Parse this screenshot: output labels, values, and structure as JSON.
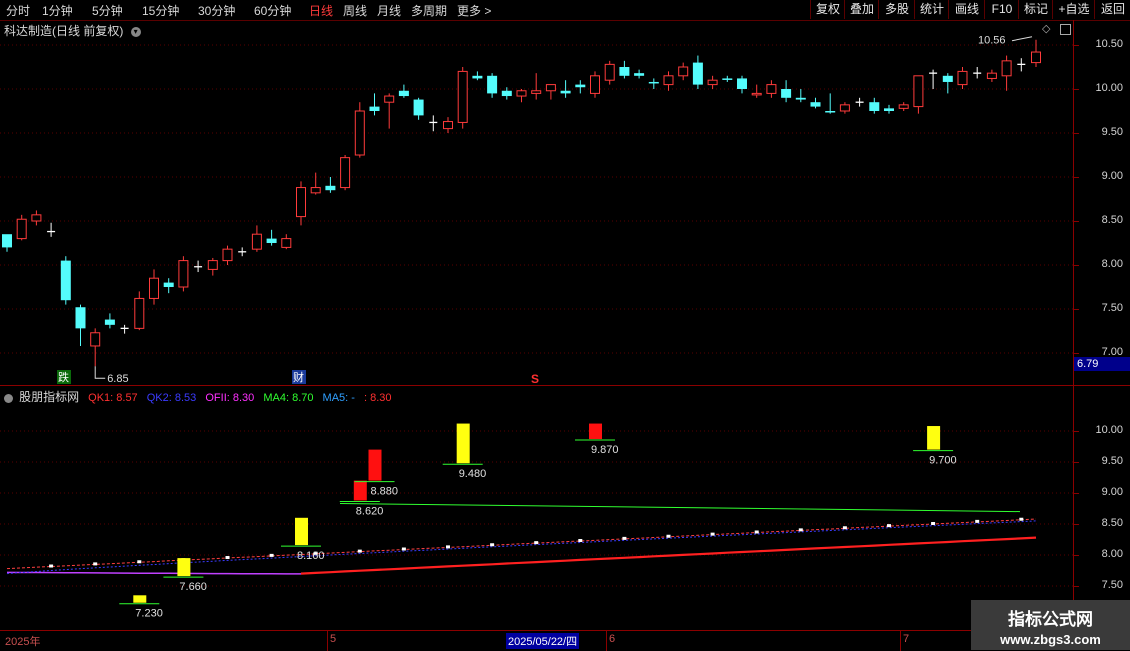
{
  "toolbar": {
    "periods": [
      "分时",
      "1分钟",
      "5分钟",
      "15分钟",
      "30分钟",
      "60分钟",
      "日线",
      "周线",
      "月线",
      "多周期",
      "更多 >"
    ],
    "active_period": "日线",
    "right_buttons": [
      "复权",
      "叠加",
      "多股",
      "统计",
      "画线",
      "F10",
      "标记",
      "+自选",
      "返回"
    ]
  },
  "main_panel": {
    "title": "科达制造(日线 前复权)",
    "price_axis": [
      "10.50",
      "10.00",
      "9.50",
      "9.00",
      "8.50",
      "8.00",
      "7.50",
      "7.00"
    ],
    "current_price": "6.79",
    "high_label": "10.56",
    "low_label": "6.85",
    "markers": {
      "die": "跌",
      "cai": "财",
      "s": "S"
    }
  },
  "indicator_panel": {
    "title": "股朋指标网",
    "legend": [
      {
        "label": "QK1: 8.57",
        "color": "#ff3030"
      },
      {
        "label": "QK2: 8.53",
        "color": "#3b3bff"
      },
      {
        "label": "OFII: 8.30",
        "color": "#ff30ff"
      },
      {
        "label": "MA4: 8.70",
        "color": "#30ff30"
      },
      {
        "label": "MA5: -",
        "color": "#30a0ff"
      },
      {
        "label": ": 8.30",
        "color": "#ff3030"
      }
    ],
    "axis": [
      "10.00",
      "9.50",
      "9.00",
      "8.50",
      "8.00",
      "7.50"
    ],
    "signal_labels": [
      "7.230",
      "7.660",
      "8.160",
      "8.620",
      "8.880",
      "9.480",
      "9.870",
      "9.700"
    ]
  },
  "date_bar": {
    "labels": [
      "2025年",
      "5",
      "2025/05/22/四",
      "6",
      "7"
    ]
  },
  "watermark": {
    "name": "指标公式网",
    "url": "www.zbgs3.com"
  },
  "chart_data": {
    "type": "candlestick",
    "title": "科达制造(日线 前复权)",
    "ylim": [
      6.79,
      10.7
    ],
    "candles": [
      {
        "o": 8.2,
        "h": 8.3,
        "l": 8.15,
        "c": 8.35,
        "color": "cyan"
      },
      {
        "o": 8.3,
        "h": 8.57,
        "l": 8.28,
        "c": 8.52
      },
      {
        "o": 8.5,
        "h": 8.62,
        "l": 8.45,
        "c": 8.57
      },
      {
        "o": 8.38,
        "h": 8.48,
        "l": 8.32,
        "c": 8.38,
        "doji": true
      },
      {
        "o": 8.05,
        "h": 8.1,
        "l": 7.55,
        "c": 7.6,
        "color": "cyan"
      },
      {
        "o": 7.52,
        "h": 7.55,
        "l": 7.08,
        "c": 7.28,
        "color": "cyan"
      },
      {
        "o": 7.08,
        "h": 7.28,
        "l": 6.85,
        "c": 7.23
      },
      {
        "o": 7.38,
        "h": 7.45,
        "l": 7.28,
        "c": 7.32,
        "color": "cyan"
      },
      {
        "o": 7.28,
        "h": 7.32,
        "l": 7.22,
        "c": 7.28,
        "doji": true
      },
      {
        "o": 7.28,
        "h": 7.7,
        "l": 7.26,
        "c": 7.62
      },
      {
        "o": 7.62,
        "h": 7.95,
        "l": 7.55,
        "c": 7.85
      },
      {
        "o": 7.8,
        "h": 7.85,
        "l": 7.68,
        "c": 7.75,
        "color": "cyan"
      },
      {
        "o": 7.75,
        "h": 8.1,
        "l": 7.7,
        "c": 8.05
      },
      {
        "o": 7.98,
        "h": 8.05,
        "l": 7.92,
        "c": 7.98,
        "doji": true
      },
      {
        "o": 7.95,
        "h": 8.08,
        "l": 7.88,
        "c": 8.05
      },
      {
        "o": 8.05,
        "h": 8.22,
        "l": 8.0,
        "c": 8.18
      },
      {
        "o": 8.15,
        "h": 8.2,
        "l": 8.1,
        "c": 8.15,
        "doji": true
      },
      {
        "o": 8.18,
        "h": 8.45,
        "l": 8.15,
        "c": 8.35
      },
      {
        "o": 8.3,
        "h": 8.4,
        "l": 8.22,
        "c": 8.25,
        "color": "cyan"
      },
      {
        "o": 8.2,
        "h": 8.35,
        "l": 8.18,
        "c": 8.3
      },
      {
        "o": 8.55,
        "h": 8.95,
        "l": 8.45,
        "c": 8.88
      },
      {
        "o": 8.82,
        "h": 9.05,
        "l": 8.8,
        "c": 8.88
      },
      {
        "o": 8.9,
        "h": 9.0,
        "l": 8.82,
        "c": 8.85,
        "color": "cyan"
      },
      {
        "o": 8.88,
        "h": 9.25,
        "l": 8.85,
        "c": 9.22
      },
      {
        "o": 9.25,
        "h": 9.85,
        "l": 9.22,
        "c": 9.75
      },
      {
        "o": 9.8,
        "h": 9.95,
        "l": 9.7,
        "c": 9.75,
        "color": "cyan"
      },
      {
        "o": 9.85,
        "h": 9.95,
        "l": 9.55,
        "c": 9.92
      },
      {
        "o": 9.98,
        "h": 10.05,
        "l": 9.9,
        "c": 9.92,
        "color": "cyan"
      },
      {
        "o": 9.88,
        "h": 9.9,
        "l": 9.65,
        "c": 9.7,
        "color": "cyan"
      },
      {
        "o": 9.62,
        "h": 9.7,
        "l": 9.52,
        "c": 9.62,
        "doji": true
      },
      {
        "o": 9.55,
        "h": 9.68,
        "l": 9.5,
        "c": 9.63
      },
      {
        "o": 9.62,
        "h": 10.25,
        "l": 9.55,
        "c": 10.2
      },
      {
        "o": 10.15,
        "h": 10.2,
        "l": 10.1,
        "c": 10.12,
        "color": "cyan"
      },
      {
        "o": 10.15,
        "h": 10.18,
        "l": 9.9,
        "c": 9.95,
        "color": "cyan"
      },
      {
        "o": 9.98,
        "h": 10.02,
        "l": 9.88,
        "c": 9.92,
        "color": "cyan"
      },
      {
        "o": 9.92,
        "h": 10.0,
        "l": 9.85,
        "c": 9.98
      },
      {
        "o": 9.95,
        "h": 10.18,
        "l": 9.88,
        "c": 9.98
      },
      {
        "o": 9.98,
        "h": 10.05,
        "l": 9.88,
        "c": 10.05
      },
      {
        "o": 9.98,
        "h": 10.1,
        "l": 9.9,
        "c": 9.95,
        "color": "cyan"
      },
      {
        "o": 10.05,
        "h": 10.1,
        "l": 9.95,
        "c": 10.02,
        "color": "cyan"
      },
      {
        "o": 9.95,
        "h": 10.2,
        "l": 9.9,
        "c": 10.15
      },
      {
        "o": 10.1,
        "h": 10.32,
        "l": 10.05,
        "c": 10.28
      },
      {
        "o": 10.25,
        "h": 10.32,
        "l": 10.12,
        "c": 10.15,
        "color": "cyan"
      },
      {
        "o": 10.18,
        "h": 10.22,
        "l": 10.12,
        "c": 10.15,
        "color": "cyan"
      },
      {
        "o": 10.08,
        "h": 10.12,
        "l": 10.0,
        "c": 10.08,
        "color": "cyan"
      },
      {
        "o": 10.05,
        "h": 10.2,
        "l": 9.98,
        "c": 10.15
      },
      {
        "o": 10.15,
        "h": 10.3,
        "l": 10.1,
        "c": 10.25
      },
      {
        "o": 10.3,
        "h": 10.38,
        "l": 10.0,
        "c": 10.05,
        "color": "cyan"
      },
      {
        "o": 10.05,
        "h": 10.15,
        "l": 10.0,
        "c": 10.1
      },
      {
        "o": 10.12,
        "h": 10.15,
        "l": 10.08,
        "c": 10.12,
        "color": "cyan"
      },
      {
        "o": 10.12,
        "h": 10.15,
        "l": 9.95,
        "c": 10.0,
        "color": "cyan"
      },
      {
        "o": 9.95,
        "h": 10.05,
        "l": 9.9,
        "c": 9.95
      },
      {
        "o": 9.95,
        "h": 10.1,
        "l": 9.9,
        "c": 10.05
      },
      {
        "o": 10.0,
        "h": 10.1,
        "l": 9.85,
        "c": 9.9,
        "color": "cyan"
      },
      {
        "o": 9.9,
        "h": 10.0,
        "l": 9.85,
        "c": 9.88,
        "color": "cyan"
      },
      {
        "o": 9.85,
        "h": 9.9,
        "l": 9.78,
        "c": 9.8,
        "color": "cyan"
      },
      {
        "o": 9.75,
        "h": 9.95,
        "l": 9.72,
        "c": 9.75,
        "color": "cyan"
      },
      {
        "o": 9.75,
        "h": 9.85,
        "l": 9.72,
        "c": 9.82
      },
      {
        "o": 9.85,
        "h": 9.9,
        "l": 9.8,
        "c": 9.85,
        "doji": true
      },
      {
        "o": 9.85,
        "h": 9.9,
        "l": 9.72,
        "c": 9.75,
        "color": "cyan"
      },
      {
        "o": 9.78,
        "h": 9.82,
        "l": 9.72,
        "c": 9.75,
        "color": "cyan"
      },
      {
        "o": 9.78,
        "h": 9.85,
        "l": 9.75,
        "c": 9.82
      },
      {
        "o": 9.8,
        "h": 10.15,
        "l": 9.72,
        "c": 10.15
      },
      {
        "o": 10.18,
        "h": 10.22,
        "l": 10.0,
        "c": 10.18,
        "doji": true
      },
      {
        "o": 10.15,
        "h": 10.18,
        "l": 9.95,
        "c": 10.08,
        "color": "cyan"
      },
      {
        "o": 10.05,
        "h": 10.25,
        "l": 10.0,
        "c": 10.2
      },
      {
        "o": 10.18,
        "h": 10.25,
        "l": 10.12,
        "c": 10.18,
        "doji": true
      },
      {
        "o": 10.12,
        "h": 10.22,
        "l": 10.08,
        "c": 10.18
      },
      {
        "o": 10.15,
        "h": 10.38,
        "l": 9.98,
        "c": 10.32
      },
      {
        "o": 10.28,
        "h": 10.35,
        "l": 10.2,
        "c": 10.28,
        "doji": true
      },
      {
        "o": 10.3,
        "h": 10.56,
        "l": 10.25,
        "c": 10.42
      }
    ],
    "indicator": {
      "ylim": [
        7.25,
        10.55
      ],
      "signals": [
        {
          "idx": 9,
          "o": 7.35,
          "c": 7.23,
          "color": "yellow",
          "label": "7.230"
        },
        {
          "idx": 12,
          "o": 7.66,
          "c": 7.95,
          "color": "yellow",
          "label": "7.660"
        },
        {
          "idx": 20,
          "o": 8.6,
          "c": 8.16,
          "color": "yellow",
          "label": "8.160"
        },
        {
          "idx": 24,
          "o": 8.88,
          "c": 9.2,
          "color": "red",
          "label": "8.620"
        },
        {
          "idx": 25,
          "o": 9.2,
          "c": 9.7,
          "color": "red",
          "label": "8.880"
        },
        {
          "idx": 31,
          "o": 9.48,
          "c": 10.12,
          "color": "yellow",
          "label": "9.480"
        },
        {
          "idx": 40,
          "o": 9.87,
          "c": 10.12,
          "color": "red",
          "label": "9.870"
        },
        {
          "idx": 63,
          "o": 9.7,
          "c": 10.08,
          "color": "yellow",
          "label": "9.700"
        }
      ]
    }
  }
}
